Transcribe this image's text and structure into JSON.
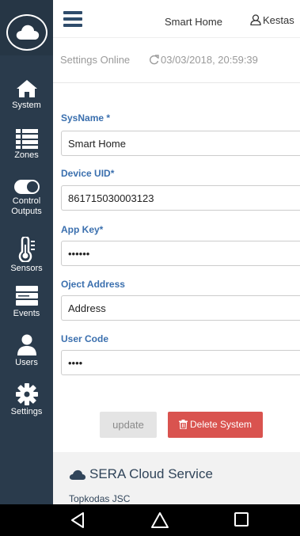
{
  "header": {
    "title": "Smart Home",
    "user_name": "Kestas"
  },
  "status": {
    "text": "Settings Online",
    "timestamp": "03/03/2018, 20:59:39"
  },
  "sidebar": {
    "items": [
      {
        "label": "System",
        "icon": "home-icon"
      },
      {
        "label": "Zones",
        "icon": "list-icon"
      },
      {
        "label": "Control Outputs",
        "icon": "toggle-icon"
      },
      {
        "label": "Sensors",
        "icon": "thermometer-icon"
      },
      {
        "label": "Events",
        "icon": "server-icon"
      },
      {
        "label": "Users",
        "icon": "user-icon"
      },
      {
        "label": "Settings",
        "icon": "gear-icon"
      }
    ]
  },
  "form": {
    "sysname": {
      "label": "SysName *",
      "value": "Smart Home"
    },
    "device_uid": {
      "label": "Device UID*",
      "value": "861715030003123"
    },
    "app_key": {
      "label": "App Key*",
      "value": "••••••"
    },
    "object_address": {
      "label": "Oject Address",
      "value": "Address"
    },
    "user_code": {
      "label": "User Code",
      "value": "••••"
    }
  },
  "buttons": {
    "update": "update",
    "delete": "Delete System"
  },
  "footer": {
    "title": "SERA Cloud Service",
    "company": "Topkodas JSC"
  },
  "colors": {
    "sidebar": "#2a3b4c",
    "label_blue": "#3a6fae",
    "delete_red": "#d9534f"
  }
}
